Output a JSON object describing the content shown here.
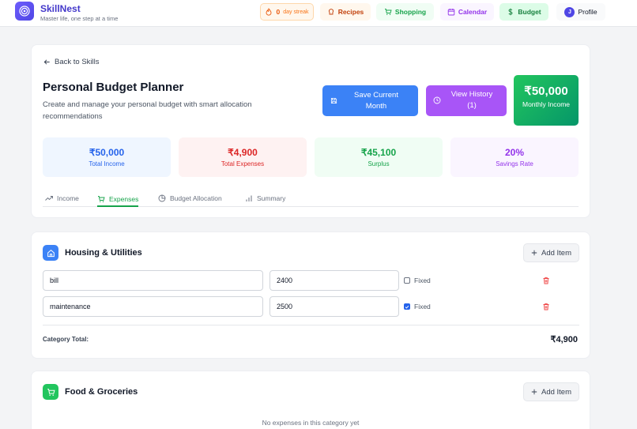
{
  "header": {
    "brand": "SkillNest",
    "tagline": "Master life, one step at a time",
    "streak_count": "0",
    "streak_label": "day streak",
    "nav": {
      "recipes": "Recipes",
      "shopping": "Shopping",
      "calendar": "Calendar",
      "budget": "Budget",
      "profile": "Profile",
      "avatar_initial": "J"
    }
  },
  "page": {
    "back_label": "Back to Skills",
    "title": "Personal Budget Planner",
    "subtitle": "Create and manage your personal budget with smart allocation recommendations",
    "save_label": "Save Current Month",
    "history_label": "View History (1)",
    "income_amount": "₹50,000",
    "income_label": "Monthly Income"
  },
  "stats": [
    {
      "value": "₹50,000",
      "label": "Total Income"
    },
    {
      "value": "₹4,900",
      "label": "Total Expenses"
    },
    {
      "value": "₹45,100",
      "label": "Surplus"
    },
    {
      "value": "20%",
      "label": "Savings Rate"
    }
  ],
  "tabs": [
    "Income",
    "Expenses",
    "Budget Allocation",
    "Summary"
  ],
  "active_tab": "Expenses",
  "categories": [
    {
      "name": "Housing & Utilities",
      "add_label": "Add Item",
      "items": [
        {
          "name": "bill",
          "amount": "2400",
          "fixed_label": "Fixed",
          "fixed": false
        },
        {
          "name": "maintenance",
          "amount": "2500",
          "fixed_label": "Fixed",
          "fixed": true
        }
      ],
      "total_label": "Category Total:",
      "total": "₹4,900"
    },
    {
      "name": "Food & Groceries",
      "add_label": "Add Item",
      "empty_text": "No expenses in this category yet"
    }
  ],
  "colors": {
    "brand": "#4338ca",
    "save_button": "#3b82f6",
    "history_button": "#a855f7",
    "income_box": "#10b981",
    "active_tab": "#16a34a"
  }
}
